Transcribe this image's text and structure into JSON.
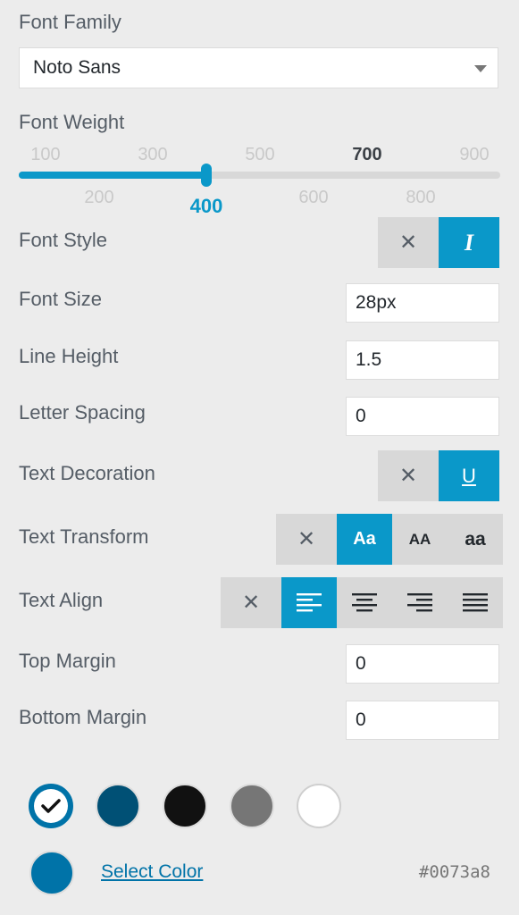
{
  "font_family": {
    "label": "Font Family",
    "value": "Noto Sans"
  },
  "font_weight": {
    "label": "Font Weight",
    "ticks_top": [
      "100",
      "300",
      "500",
      "700",
      "900"
    ],
    "ticks_bottom": [
      "200",
      "400",
      "600",
      "800"
    ],
    "selected": "400",
    "bold_value": "700"
  },
  "font_style": {
    "label": "Font Style",
    "options": [
      {
        "icon": "close-icon",
        "glyph": "✕"
      },
      {
        "icon": "italic-icon",
        "glyph": "I"
      }
    ],
    "selected_index": 1
  },
  "font_size": {
    "label": "Font Size",
    "value": "28px"
  },
  "line_height": {
    "label": "Line Height",
    "value": "1.5"
  },
  "letter_spacing": {
    "label": "Letter Spacing",
    "value": "0"
  },
  "text_decoration": {
    "label": "Text Decoration",
    "options": [
      {
        "icon": "close-icon",
        "glyph": "✕"
      },
      {
        "icon": "underline-icon",
        "glyph": "U"
      }
    ],
    "selected_index": 1
  },
  "text_transform": {
    "label": "Text Transform",
    "options": [
      {
        "icon": "close-icon",
        "glyph": "✕"
      },
      {
        "text": "Aa"
      },
      {
        "text": "AA"
      },
      {
        "text": "aa"
      }
    ],
    "selected_index": 1
  },
  "text_align": {
    "label": "Text Align",
    "options": [
      "none",
      "left",
      "center",
      "right",
      "justify"
    ],
    "selected_index": 1
  },
  "top_margin": {
    "label": "Top Margin",
    "value": "0"
  },
  "bottom_margin": {
    "label": "Bottom Margin",
    "value": "0"
  },
  "colors": {
    "swatches": [
      "#0073a8",
      "#005075",
      "#111111",
      "#767676",
      "#ffffff"
    ],
    "selected_index": 0,
    "current": "#0073a8",
    "select_label": "Select Color",
    "hex": "#0073a8"
  },
  "accent": "#0a98c9"
}
